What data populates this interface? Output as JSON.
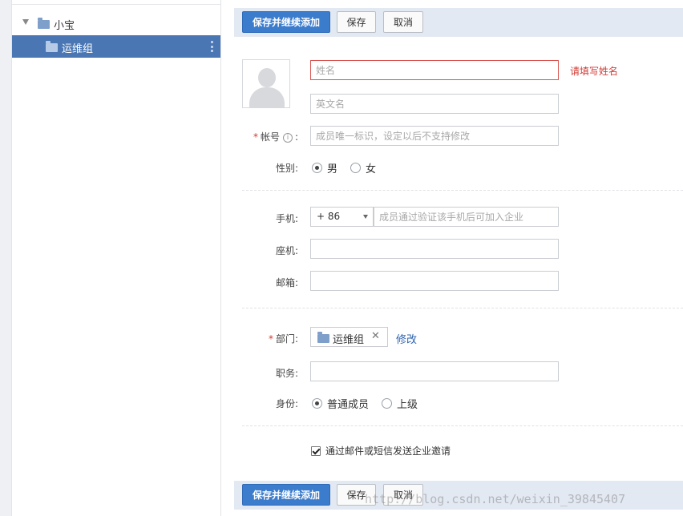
{
  "sidebar": {
    "root": {
      "label": "小宝"
    },
    "child": {
      "label": "运维组"
    }
  },
  "toolbar": {
    "save_continue_label": "保存并继续添加",
    "save_label": "保存",
    "cancel_label": "取消"
  },
  "form": {
    "name": {
      "placeholder": "姓名",
      "value": "",
      "error": "请填写姓名"
    },
    "english_name": {
      "placeholder": "英文名",
      "value": ""
    },
    "account": {
      "label": "帐号",
      "required_mark": "*",
      "info_glyph": "i",
      "placeholder": "成员唯一标识，设定以后不支持修改",
      "value": ""
    },
    "gender": {
      "label": "性别:",
      "options": [
        "男",
        "女"
      ],
      "selected": "男"
    },
    "mobile": {
      "label": "手机:",
      "country_code": "+ 86",
      "placeholder": "成员通过验证该手机后可加入企业",
      "value": ""
    },
    "phone": {
      "label": "座机:",
      "value": ""
    },
    "email": {
      "label": "邮箱:",
      "value": ""
    },
    "department": {
      "label": "部门:",
      "required_mark": "*",
      "value": "运维组",
      "remove_glyph": "✕",
      "edit_link": "修改"
    },
    "position": {
      "label": "职务:",
      "value": ""
    },
    "identity": {
      "label": "身份:",
      "options": [
        "普通成员",
        "上级"
      ],
      "selected": "普通成员"
    },
    "invite": {
      "label": "通过邮件或短信发送企业邀请",
      "checked": true
    }
  },
  "watermark": "http://blog.csdn.net/weixin_39845407"
}
